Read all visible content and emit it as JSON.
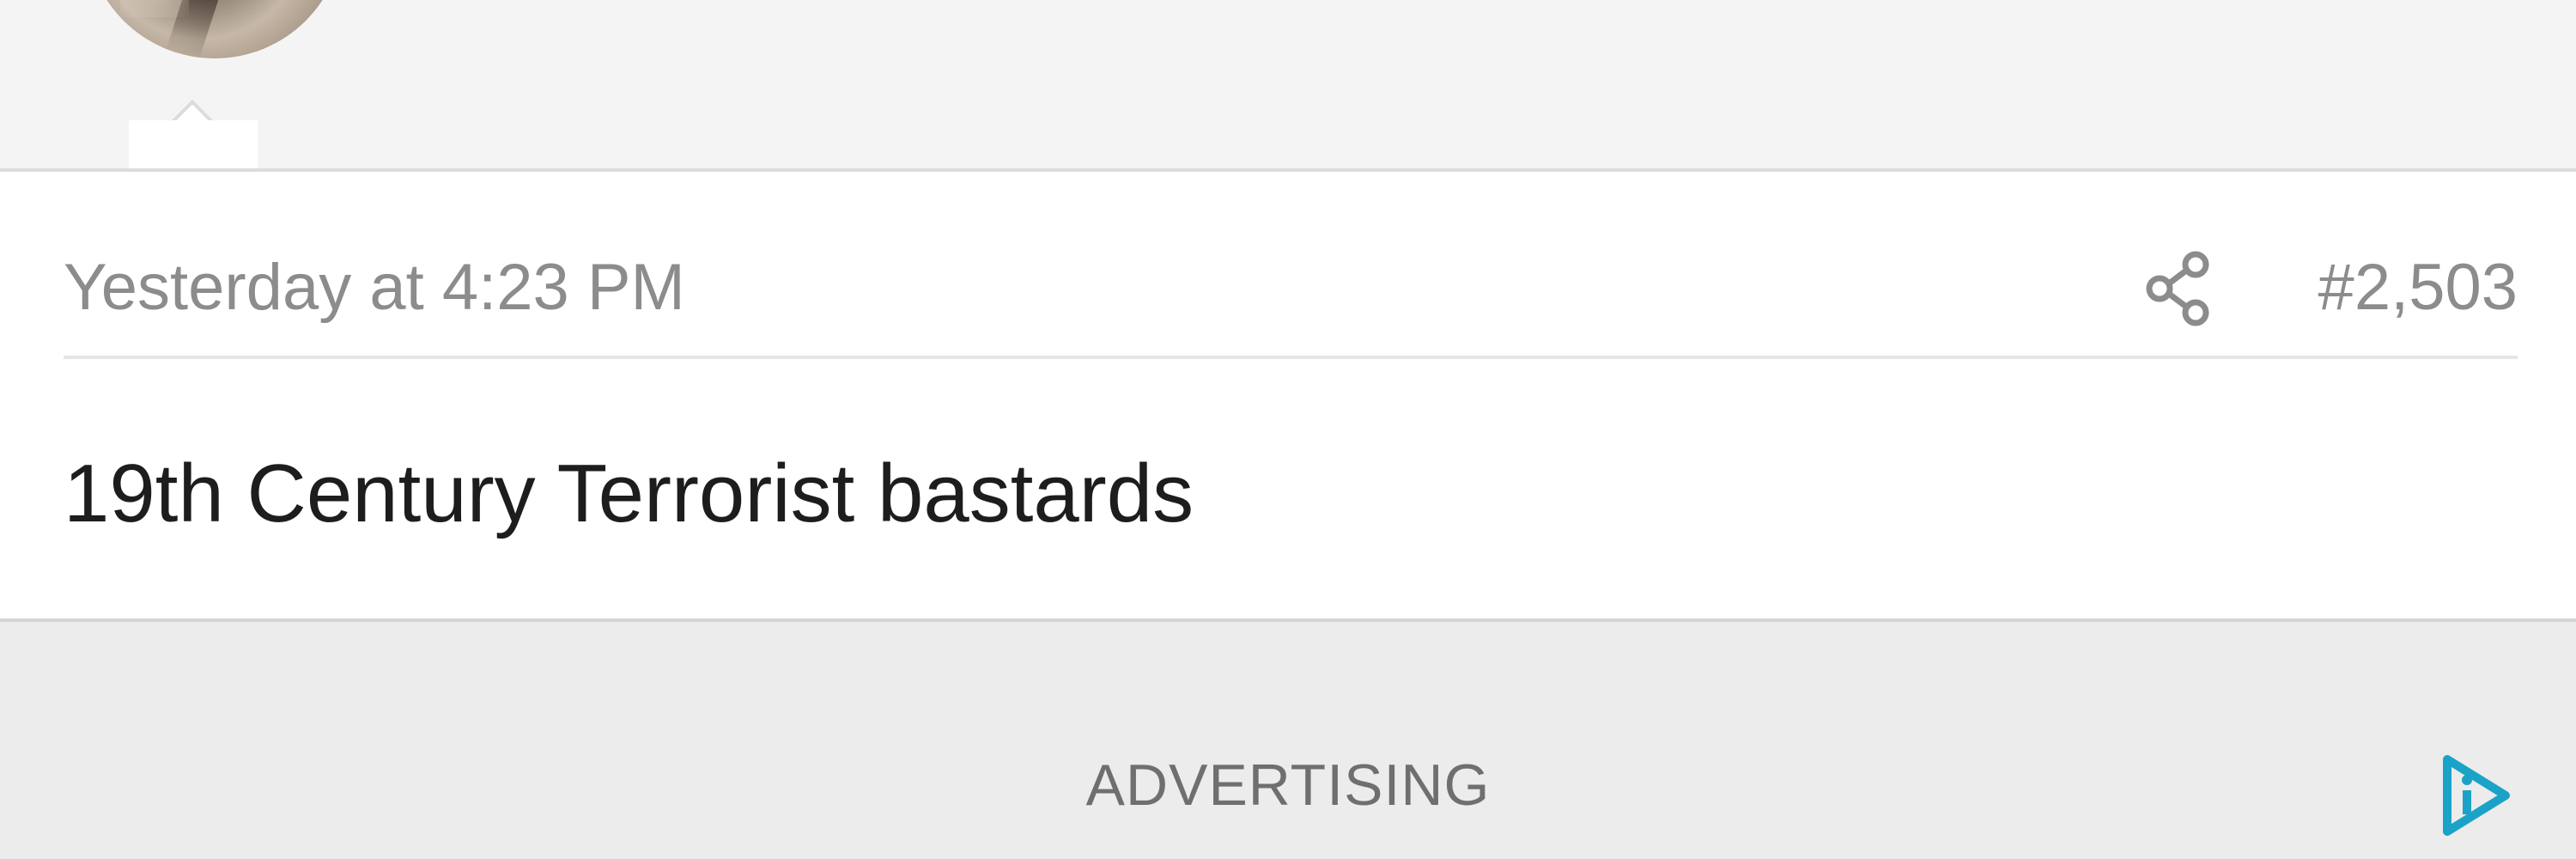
{
  "post": {
    "timestamp": "Yesterday at 4:23 PM",
    "post_number": "#2,503",
    "body": "19th Century Terrorist bastards",
    "share_icon": "share-icon"
  },
  "ad": {
    "label": "ADVERTISING",
    "logo_icon": "ad-choices-icon"
  },
  "colors": {
    "meta_text": "#8c8c8c",
    "body_text": "#1d1d1d",
    "ad_accent": "#1ba3c7"
  }
}
